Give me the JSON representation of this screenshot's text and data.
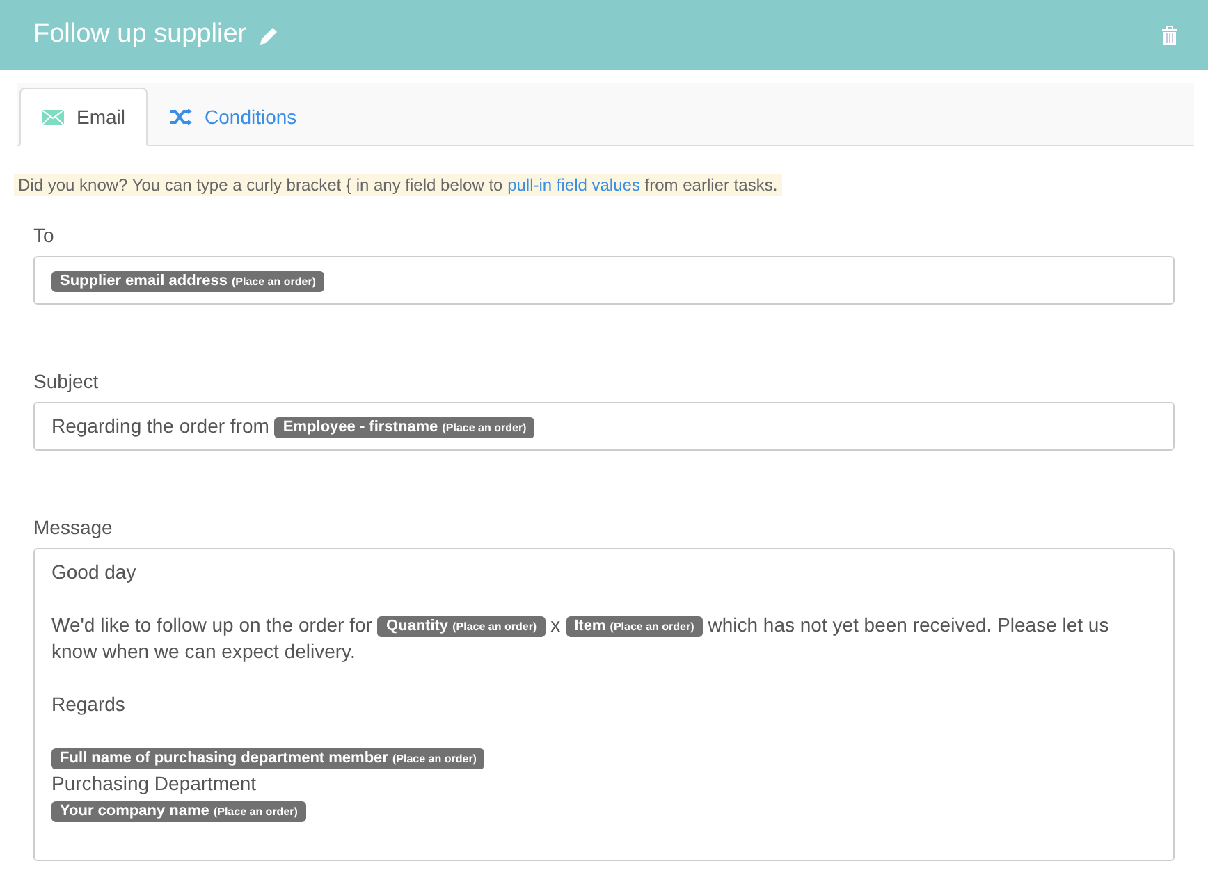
{
  "header": {
    "title": "Follow up supplier"
  },
  "tabs": [
    {
      "label": "Email",
      "selected": true,
      "kind": "email"
    },
    {
      "label": "Conditions",
      "selected": false,
      "kind": "shuffle"
    }
  ],
  "tip": {
    "before": "Did you know? You can type a curly bracket { in any field below to",
    "link": "pull-in field values",
    "after": "from earlier tasks."
  },
  "fields": [
    {
      "label": "To",
      "kind": "single",
      "lines": [
        {
          "kind": "content",
          "segments": [
            {
              "kind": "token",
              "name": "Supplier email address",
              "source": "(Place an order)"
            }
          ]
        }
      ]
    },
    {
      "label": "Subject",
      "kind": "single",
      "lines": [
        {
          "kind": "content",
          "segments": [
            {
              "kind": "text",
              "text": "Regarding the order from"
            },
            {
              "kind": "token",
              "name": "Employee - firstname",
              "source": "(Place an order)"
            }
          ]
        }
      ]
    },
    {
      "label": "Message",
      "kind": "multi",
      "lines": [
        {
          "kind": "content",
          "segments": [
            {
              "kind": "text",
              "text": "Good day"
            }
          ]
        },
        {
          "kind": "blank"
        },
        {
          "kind": "content",
          "segments": [
            {
              "kind": "text",
              "text": "We'd like to follow up on the order for"
            },
            {
              "kind": "token",
              "name": "Quantity",
              "source": "(Place an order)"
            },
            {
              "kind": "text",
              "text": "x"
            },
            {
              "kind": "token",
              "name": "Item",
              "source": "(Place an order)"
            },
            {
              "kind": "text",
              "text": "which has not yet been received. Please let us"
            }
          ]
        },
        {
          "kind": "content",
          "segments": [
            {
              "kind": "text",
              "text": "know when we can expect delivery."
            }
          ]
        },
        {
          "kind": "blank"
        },
        {
          "kind": "content",
          "segments": [
            {
              "kind": "text",
              "text": "Regards"
            }
          ]
        },
        {
          "kind": "blank"
        },
        {
          "kind": "content",
          "segments": [
            {
              "kind": "token",
              "name": "Full name of purchasing department member",
              "source": "(Place an order)"
            }
          ]
        },
        {
          "kind": "content",
          "segments": [
            {
              "kind": "text",
              "text": "Purchasing Department"
            }
          ]
        },
        {
          "kind": "content",
          "segments": [
            {
              "kind": "token",
              "name": "Your company name",
              "source": "(Place an order)"
            }
          ]
        }
      ]
    }
  ]
}
